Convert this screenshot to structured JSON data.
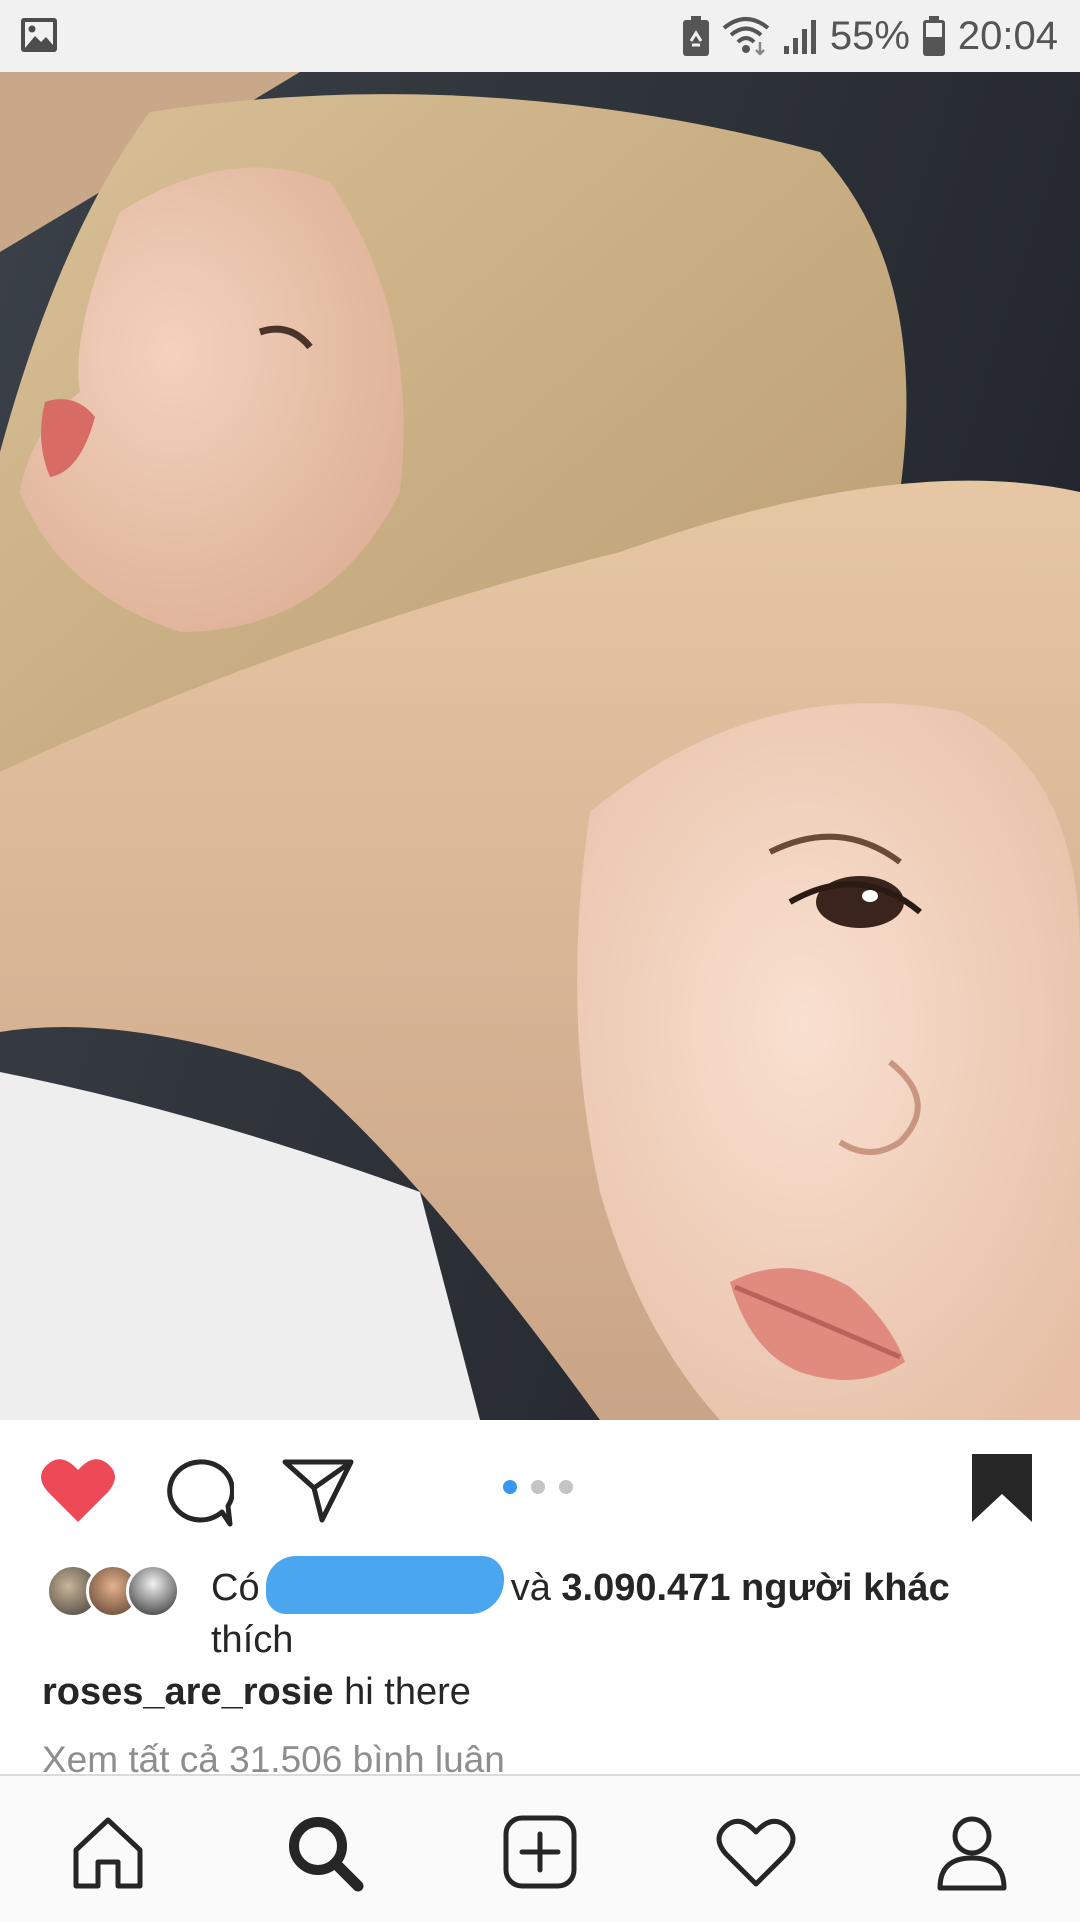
{
  "status_bar": {
    "battery_percent": "55%",
    "time": "20:04",
    "icons": [
      "gallery-icon",
      "battery-saver-icon",
      "wifi-icon",
      "signal-icon",
      "battery-icon"
    ]
  },
  "post": {
    "image_alt": "photo",
    "carousel": {
      "count": 3,
      "active_index": 0
    },
    "liked": true,
    "saved": true,
    "likes": {
      "prefix": "Có",
      "conjunction": "và",
      "count_text": "3.090.471 người khác",
      "suffix": "thích"
    },
    "caption": {
      "username": "roses_are_rosie",
      "text": "hi there"
    },
    "view_comments": "Xem tất cả 31.506 bình luận"
  },
  "colors": {
    "like_red": "#ed4956",
    "active_dot": "#3897f0",
    "redaction_blue": "#4aa6ee"
  },
  "bottom_nav": {
    "items": [
      "home-icon",
      "search-icon",
      "add-post-icon",
      "activity-heart-icon",
      "profile-icon"
    ],
    "active": "search-icon"
  }
}
